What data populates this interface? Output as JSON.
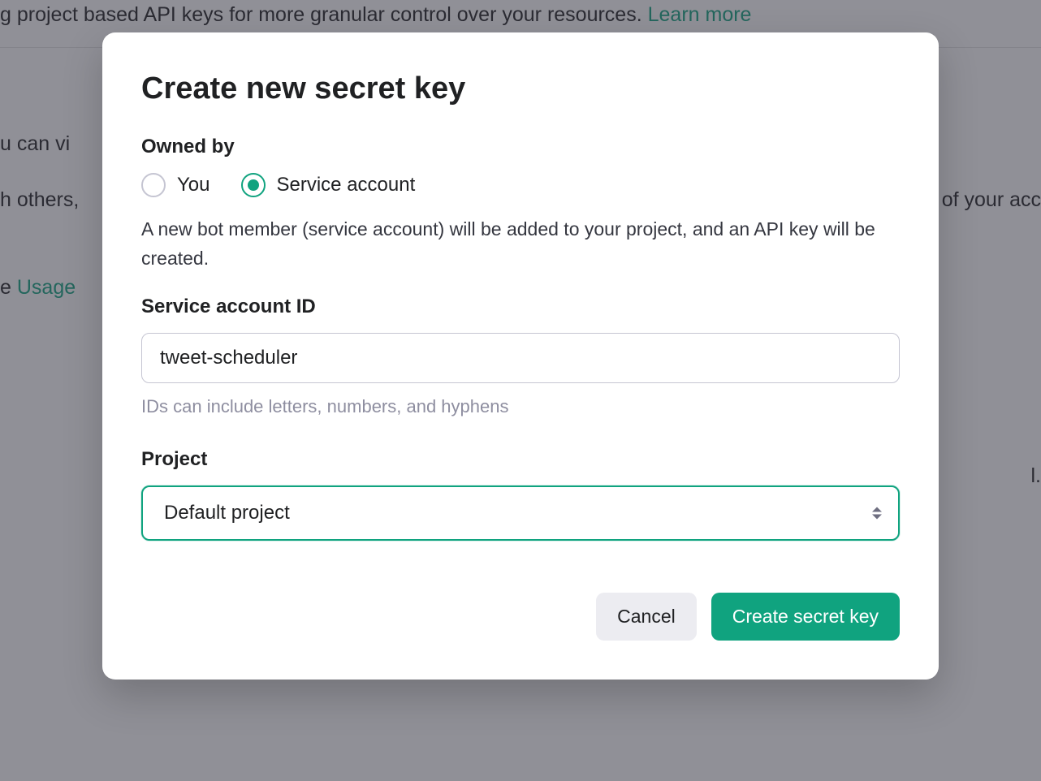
{
  "background": {
    "banner_fragment": "g project based API keys for more granular control over your resources. ",
    "banner_link": "Learn more",
    "line1": "u can vi",
    "line2": "h others,",
    "line2_right": "of your acc",
    "line3_prefix": "e ",
    "line3_link": "Usage",
    "line4_right": "l."
  },
  "modal": {
    "title": "Create new secret key",
    "owned_by_label": "Owned by",
    "radio_you": "You",
    "radio_service": "Service account",
    "service_description": "A new bot member (service account) will be added to your project, and an API key will be created.",
    "service_id_label": "Service account ID",
    "service_id_value": "tweet-scheduler",
    "service_id_helper": "IDs can include letters, numbers, and hyphens",
    "project_label": "Project",
    "project_selected": "Default project",
    "cancel_label": "Cancel",
    "create_label": "Create secret key"
  }
}
